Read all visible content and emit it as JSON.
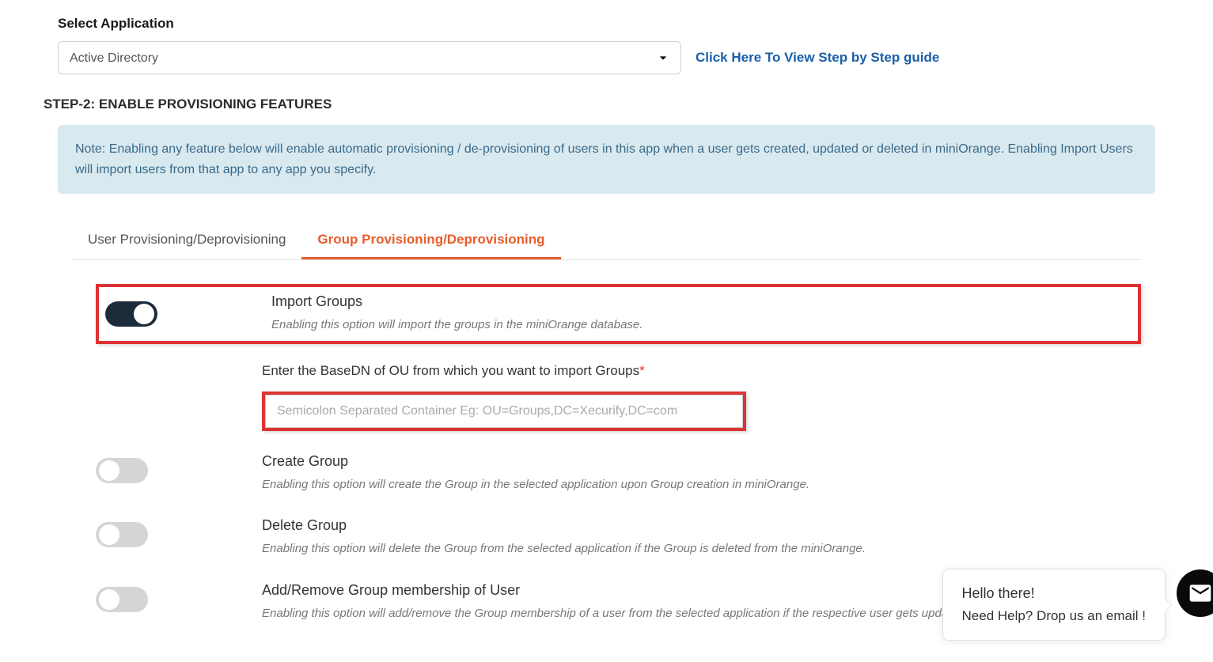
{
  "selectApp": {
    "label": "Select Application",
    "value": "Active Directory"
  },
  "guideLink": "Click Here To View Step by Step guide",
  "stepTitle": "STEP-2: ENABLE PROVISIONING FEATURES",
  "infoNote": "Note: Enabling any feature below will enable automatic provisioning / de-provisioning of users in this app when a user gets created, updated or deleted in miniOrange. Enabling Import Users will import users from that app to any app you specify.",
  "tabs": {
    "user": "User Provisioning/Deprovisioning",
    "group": "Group Provisioning/Deprovisioning"
  },
  "options": {
    "importGroups": {
      "title": "Import Groups",
      "desc": "Enabling this option will import the groups in the miniOrange database."
    },
    "basedn": {
      "label": "Enter the BaseDN of OU from which you want to import Groups",
      "placeholder": "Semicolon Separated Container Eg: OU=Groups,DC=Xecurify,DC=com"
    },
    "createGroup": {
      "title": "Create Group",
      "desc": "Enabling this option will create the Group in the selected application upon Group creation in miniOrange."
    },
    "deleteGroup": {
      "title": "Delete Group",
      "desc": "Enabling this option will delete the Group from the selected application if the Group is deleted from the miniOrange."
    },
    "membership": {
      "title": "Add/Remove Group membership of User",
      "desc": "Enabling this option will add/remove the Group membership of a user from the selected application if the respective user gets updated from the miniOrange."
    }
  },
  "chat": {
    "hello": "Hello there!",
    "help": "Need Help? Drop us an email !"
  }
}
